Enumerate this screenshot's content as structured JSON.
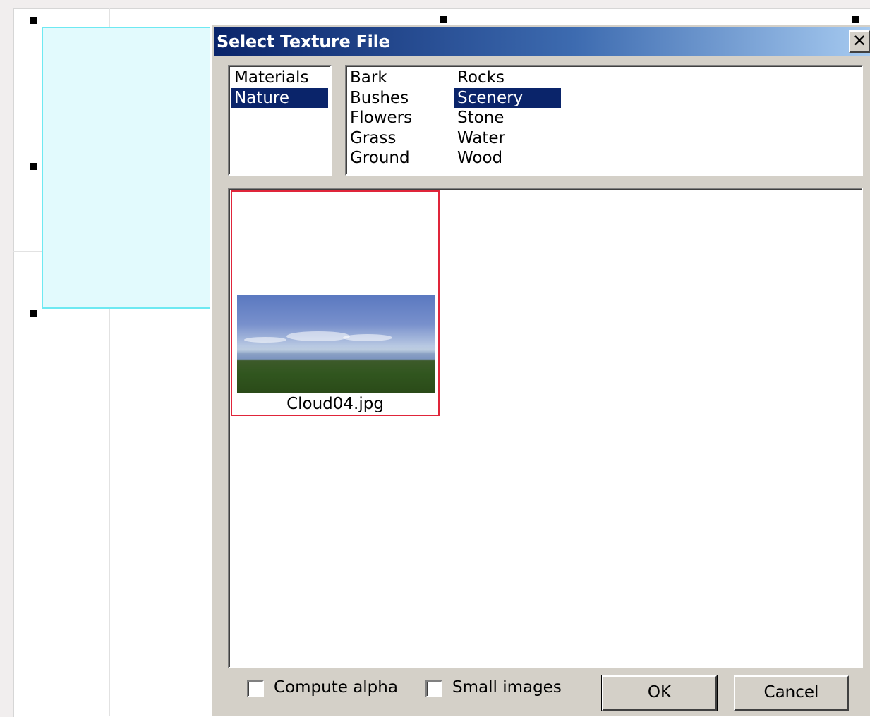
{
  "dialog": {
    "title": "Select Texture File",
    "close_label": "✕",
    "categories": [
      {
        "label": "Materials",
        "selected": false
      },
      {
        "label": "Nature",
        "selected": true
      }
    ],
    "subcategories_col1": [
      {
        "label": "Bark",
        "selected": false
      },
      {
        "label": "Bushes",
        "selected": false
      },
      {
        "label": "Flowers",
        "selected": false
      },
      {
        "label": "Grass",
        "selected": false
      },
      {
        "label": "Ground",
        "selected": false
      }
    ],
    "subcategories_col2": [
      {
        "label": "Rocks",
        "selected": false
      },
      {
        "label": "Scenery",
        "selected": true
      },
      {
        "label": "Stone",
        "selected": false
      },
      {
        "label": "Water",
        "selected": false
      },
      {
        "label": "Wood",
        "selected": false
      }
    ],
    "files": [
      {
        "name": "Cloud04.jpg",
        "selected": true
      }
    ],
    "options": {
      "compute_alpha_label": "Compute alpha",
      "compute_alpha_checked": false,
      "small_images_label": "Small images",
      "small_images_checked": false
    },
    "buttons": {
      "ok_label": "OK",
      "cancel_label": "Cancel"
    }
  },
  "colors": {
    "selection_bg": "#0a246a",
    "thumb_border": "#e0253a",
    "canvas_rect_fill": "#e2fafd",
    "canvas_rect_border": "#6ee9f2"
  }
}
